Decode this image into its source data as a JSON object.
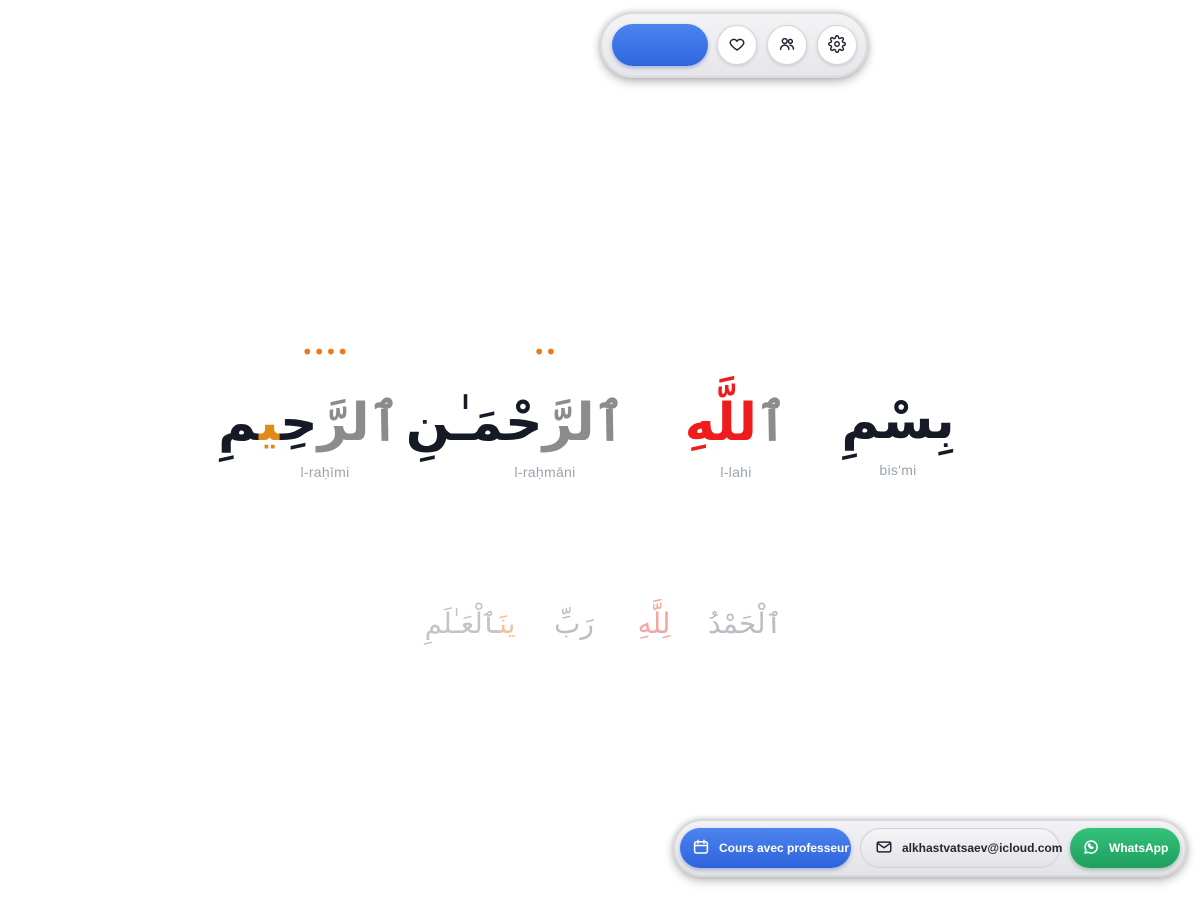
{
  "toolbar": {
    "icons": [
      "heart-icon",
      "users-icon",
      "gear-icon"
    ],
    "accent": "#3a74e6"
  },
  "verse": {
    "words": [
      {
        "arabic_segments": [
          {
            "text": "بِسْمِ",
            "color": "dark"
          }
        ],
        "transliteration": "bis'mi"
      },
      {
        "arabic_segments": [
          {
            "text": "ٱ",
            "color": "gray"
          },
          {
            "text": "للَّهِ",
            "color": "red"
          }
        ],
        "transliteration": "l-lahi"
      },
      {
        "arabic_segments": [
          {
            "text": "ٱ",
            "color": "gray"
          },
          {
            "text": "لرَّ",
            "color": "gray"
          },
          {
            "text": "حْمَـٰنِ",
            "color": "dark"
          }
        ],
        "transliteration": "l-raḥmāni",
        "marker": "••"
      },
      {
        "arabic_segments": [
          {
            "text": "ٱ",
            "color": "gray"
          },
          {
            "text": "لرَّ",
            "color": "gray"
          },
          {
            "text": "حِ",
            "color": "dark"
          },
          {
            "text": "ي",
            "color": "orange"
          },
          {
            "text": "مِ",
            "color": "dark"
          }
        ],
        "transliteration": "l-raḥīmi",
        "marker": "••••"
      }
    ],
    "colors": {
      "dark": "#161a26",
      "red": "#ee1c1c",
      "gray": "#8c8c8c",
      "orange": "#e08a1c"
    }
  },
  "next_verse": {
    "words": [
      "ٱلْحَمْدُ",
      "لِلَّهِ",
      "رَبِّ",
      "ٱلْعَـٰلَمِ",
      "ينَ"
    ]
  },
  "bottom_bar": {
    "teacher_label": "Cours avec professeur",
    "email_label": "alkhastvatsaev@icloud.com",
    "whatsapp_label": "WhatsApp"
  }
}
